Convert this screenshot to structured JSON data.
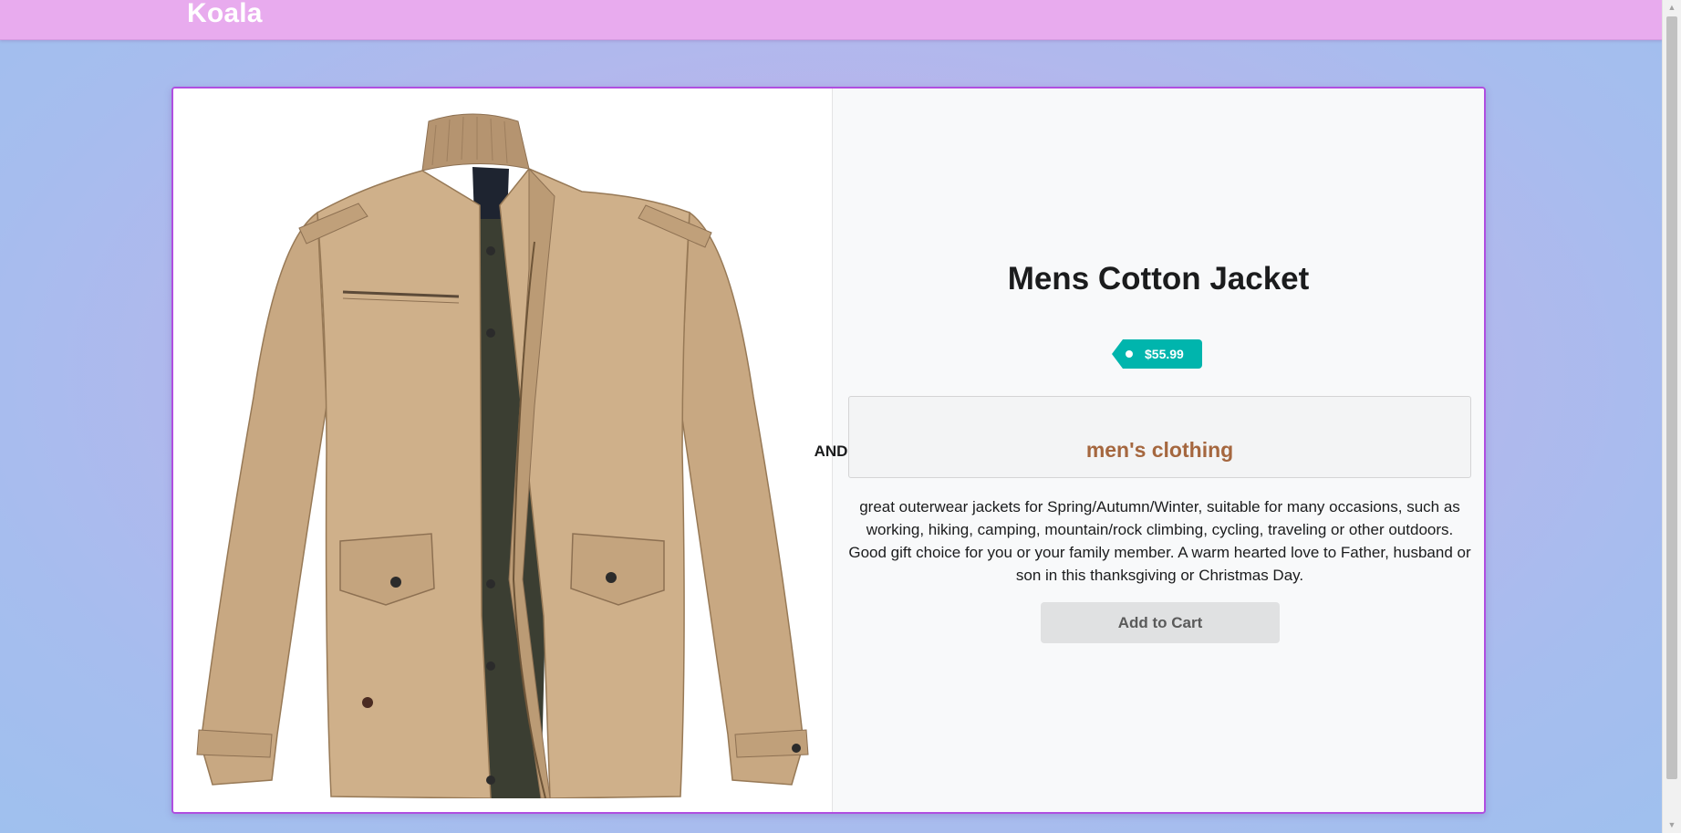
{
  "header": {
    "brand": "Koala"
  },
  "product": {
    "title": "Mens Cotton Jacket",
    "price": "$55.99",
    "category": "men's clothing",
    "divider_label": "AND",
    "description": "great outerwear jackets for Spring/Autumn/Winter, suitable for many occasions, such as working, hiking, camping, mountain/rock climbing, cycling, traveling or other outdoors. Good gift choice for you or your family member. A warm hearted love to Father, husband or son in this thanksgiving or Christmas Day.",
    "add_to_cart_label": "Add to Cart",
    "image_icon": "jacket-image"
  },
  "colors": {
    "header_bg": "#e8abee",
    "card_border": "#b04ee0",
    "price_tag": "#00b5ad",
    "category_text": "#a5673f",
    "button_bg": "#e0e1e2"
  }
}
